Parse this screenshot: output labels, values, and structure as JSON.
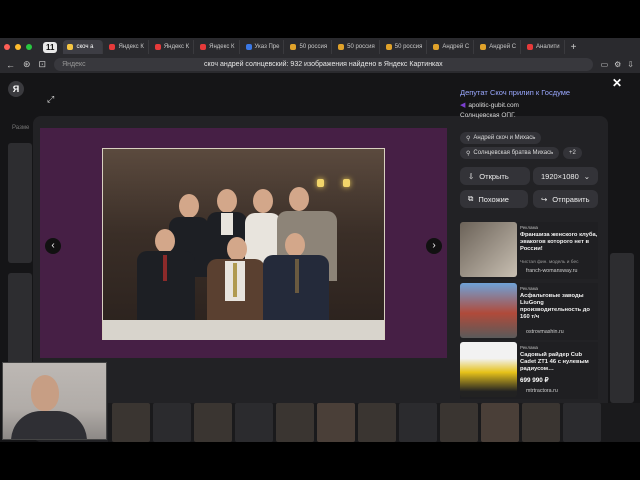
{
  "browser": {
    "tab_count": "11",
    "tabs": [
      {
        "label": "скоч а",
        "active": true,
        "fav_color": "#f5c542"
      },
      {
        "label": "Яндекс К",
        "active": false,
        "fav_color": "#e63a3a"
      },
      {
        "label": "Яндекс К",
        "active": false,
        "fav_color": "#e63a3a"
      },
      {
        "label": "Яндекс К",
        "active": false,
        "fav_color": "#e63a3a"
      },
      {
        "label": "Указ Пре",
        "active": false,
        "fav_color": "#3a78e6"
      },
      {
        "label": "50 россия",
        "active": false,
        "fav_color": "#e0a22a"
      },
      {
        "label": "50 россия",
        "active": false,
        "fav_color": "#e0a22a"
      },
      {
        "label": "50 россия",
        "active": false,
        "fav_color": "#e0a22a"
      },
      {
        "label": "Андрей С",
        "active": false,
        "fav_color": "#e0a22a"
      },
      {
        "label": "Андрей С",
        "active": false,
        "fav_color": "#e0a22a"
      },
      {
        "label": "Аналити",
        "active": false,
        "fav_color": "#e63a3a"
      }
    ],
    "address": {
      "site": "Яндекс",
      "page_title": "скоч андрей солнцевский: 932 изображения найдено в Яндекс Картинках"
    }
  },
  "page": {
    "side_text": "Разме",
    "info": {
      "title": "Депутат Скоч прилип к Госдуме",
      "source": "apolitic-gubit.com",
      "description": "Солнцевская ОПГ."
    },
    "chips": [
      {
        "label": "Андрей скоч и Михась"
      },
      {
        "label": "Солнцевская братва Михась"
      },
      {
        "label": "+2"
      }
    ],
    "open_button": "Открыть",
    "size_label": "1920×1080",
    "similar_button": "Похожие",
    "send_button": "Отправить",
    "ads": [
      {
        "tag": "Реклама",
        "title": "Франшиза женского клуба, эвакогов которого нет в России!",
        "subtitle": "Чистая фин. модель и бес",
        "domain": "franch-womansway.ru",
        "price": ""
      },
      {
        "tag": "Реклама",
        "title": "Асфальтовые заводы LiuGong производительность до 160 т/ч",
        "subtitle": "",
        "domain": "ostrovmashin.ru",
        "price": ""
      },
      {
        "tag": "Реклама",
        "title": "Садовый райдер Cub Cadet ZT1 46 с нулевым радиусом…",
        "subtitle": "",
        "domain": "mtrtractora.ru",
        "price": "699 990 ₽"
      }
    ]
  },
  "colors": {
    "viewer_bg": "#461f45",
    "link_blue": "#9aa8ff",
    "chrome_bg": "#2a2a2e"
  }
}
